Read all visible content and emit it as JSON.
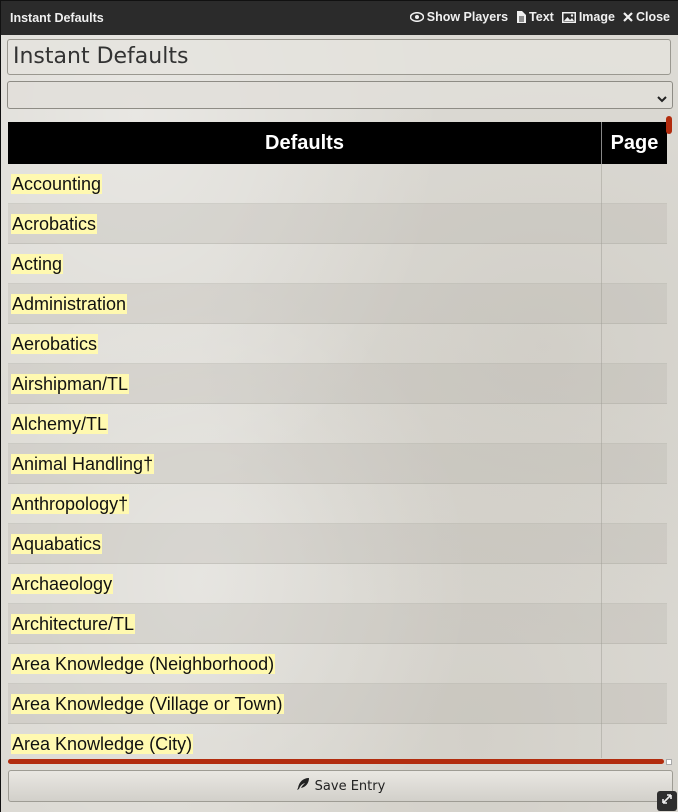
{
  "window": {
    "title": "Instant Defaults",
    "actions": [
      {
        "label": "Show Players",
        "icon": "eye-icon"
      },
      {
        "label": "Text",
        "icon": "document-icon"
      },
      {
        "label": "Image",
        "icon": "image-icon"
      },
      {
        "label": "Close",
        "icon": "close-icon"
      }
    ]
  },
  "entry": {
    "name_value": "Instant Defaults",
    "select_value": ""
  },
  "table": {
    "headers": [
      "Defaults",
      "Page"
    ],
    "rows": [
      {
        "default": "Accounting",
        "page": ""
      },
      {
        "default": "Acrobatics",
        "page": ""
      },
      {
        "default": "Acting",
        "page": ""
      },
      {
        "default": "Administration",
        "page": ""
      },
      {
        "default": "Aerobatics",
        "page": ""
      },
      {
        "default": "Airshipman/TL",
        "page": ""
      },
      {
        "default": "Alchemy/TL",
        "page": ""
      },
      {
        "default": "Animal Handling†",
        "page": ""
      },
      {
        "default": "Anthropology†",
        "page": ""
      },
      {
        "default": "Aquabatics",
        "page": ""
      },
      {
        "default": "Archaeology",
        "page": ""
      },
      {
        "default": "Architecture/TL",
        "page": ""
      },
      {
        "default": "Area Knowledge (Neighborhood)",
        "page": ""
      },
      {
        "default": "Area Knowledge (Village or Town)",
        "page": ""
      },
      {
        "default": "Area Knowledge (City)",
        "page": ""
      }
    ]
  },
  "footer": {
    "save_label": "Save Entry",
    "save_icon": "feather-icon"
  },
  "colors": {
    "header_bg": "#000000",
    "highlight": "#fff9b0",
    "accent": "#b22c0e"
  }
}
